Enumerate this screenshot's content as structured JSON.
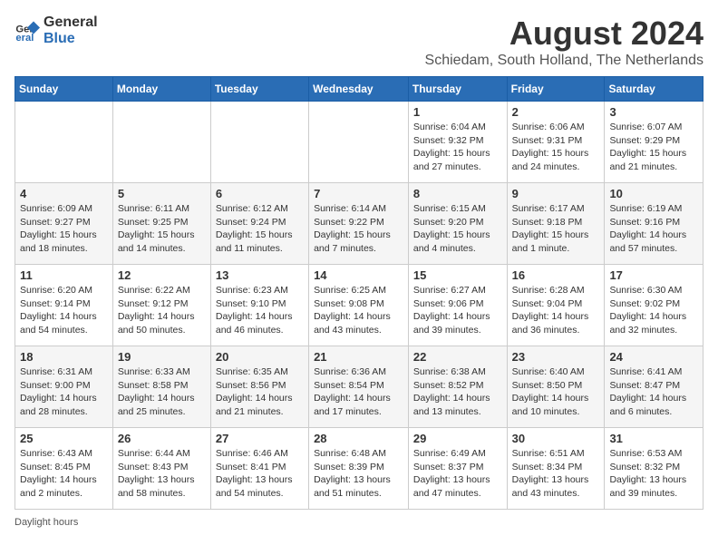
{
  "header": {
    "logo_general": "General",
    "logo_blue": "Blue",
    "main_title": "August 2024",
    "subtitle": "Schiedam, South Holland, The Netherlands"
  },
  "calendar": {
    "days_of_week": [
      "Sunday",
      "Monday",
      "Tuesday",
      "Wednesday",
      "Thursday",
      "Friday",
      "Saturday"
    ],
    "weeks": [
      [
        {
          "day": "",
          "info": ""
        },
        {
          "day": "",
          "info": ""
        },
        {
          "day": "",
          "info": ""
        },
        {
          "day": "",
          "info": ""
        },
        {
          "day": "1",
          "info": "Sunrise: 6:04 AM\nSunset: 9:32 PM\nDaylight: 15 hours and 27 minutes."
        },
        {
          "day": "2",
          "info": "Sunrise: 6:06 AM\nSunset: 9:31 PM\nDaylight: 15 hours and 24 minutes."
        },
        {
          "day": "3",
          "info": "Sunrise: 6:07 AM\nSunset: 9:29 PM\nDaylight: 15 hours and 21 minutes."
        }
      ],
      [
        {
          "day": "4",
          "info": "Sunrise: 6:09 AM\nSunset: 9:27 PM\nDaylight: 15 hours and 18 minutes."
        },
        {
          "day": "5",
          "info": "Sunrise: 6:11 AM\nSunset: 9:25 PM\nDaylight: 15 hours and 14 minutes."
        },
        {
          "day": "6",
          "info": "Sunrise: 6:12 AM\nSunset: 9:24 PM\nDaylight: 15 hours and 11 minutes."
        },
        {
          "day": "7",
          "info": "Sunrise: 6:14 AM\nSunset: 9:22 PM\nDaylight: 15 hours and 7 minutes."
        },
        {
          "day": "8",
          "info": "Sunrise: 6:15 AM\nSunset: 9:20 PM\nDaylight: 15 hours and 4 minutes."
        },
        {
          "day": "9",
          "info": "Sunrise: 6:17 AM\nSunset: 9:18 PM\nDaylight: 15 hours and 1 minute."
        },
        {
          "day": "10",
          "info": "Sunrise: 6:19 AM\nSunset: 9:16 PM\nDaylight: 14 hours and 57 minutes."
        }
      ],
      [
        {
          "day": "11",
          "info": "Sunrise: 6:20 AM\nSunset: 9:14 PM\nDaylight: 14 hours and 54 minutes."
        },
        {
          "day": "12",
          "info": "Sunrise: 6:22 AM\nSunset: 9:12 PM\nDaylight: 14 hours and 50 minutes."
        },
        {
          "day": "13",
          "info": "Sunrise: 6:23 AM\nSunset: 9:10 PM\nDaylight: 14 hours and 46 minutes."
        },
        {
          "day": "14",
          "info": "Sunrise: 6:25 AM\nSunset: 9:08 PM\nDaylight: 14 hours and 43 minutes."
        },
        {
          "day": "15",
          "info": "Sunrise: 6:27 AM\nSunset: 9:06 PM\nDaylight: 14 hours and 39 minutes."
        },
        {
          "day": "16",
          "info": "Sunrise: 6:28 AM\nSunset: 9:04 PM\nDaylight: 14 hours and 36 minutes."
        },
        {
          "day": "17",
          "info": "Sunrise: 6:30 AM\nSunset: 9:02 PM\nDaylight: 14 hours and 32 minutes."
        }
      ],
      [
        {
          "day": "18",
          "info": "Sunrise: 6:31 AM\nSunset: 9:00 PM\nDaylight: 14 hours and 28 minutes."
        },
        {
          "day": "19",
          "info": "Sunrise: 6:33 AM\nSunset: 8:58 PM\nDaylight: 14 hours and 25 minutes."
        },
        {
          "day": "20",
          "info": "Sunrise: 6:35 AM\nSunset: 8:56 PM\nDaylight: 14 hours and 21 minutes."
        },
        {
          "day": "21",
          "info": "Sunrise: 6:36 AM\nSunset: 8:54 PM\nDaylight: 14 hours and 17 minutes."
        },
        {
          "day": "22",
          "info": "Sunrise: 6:38 AM\nSunset: 8:52 PM\nDaylight: 14 hours and 13 minutes."
        },
        {
          "day": "23",
          "info": "Sunrise: 6:40 AM\nSunset: 8:50 PM\nDaylight: 14 hours and 10 minutes."
        },
        {
          "day": "24",
          "info": "Sunrise: 6:41 AM\nSunset: 8:47 PM\nDaylight: 14 hours and 6 minutes."
        }
      ],
      [
        {
          "day": "25",
          "info": "Sunrise: 6:43 AM\nSunset: 8:45 PM\nDaylight: 14 hours and 2 minutes."
        },
        {
          "day": "26",
          "info": "Sunrise: 6:44 AM\nSunset: 8:43 PM\nDaylight: 13 hours and 58 minutes."
        },
        {
          "day": "27",
          "info": "Sunrise: 6:46 AM\nSunset: 8:41 PM\nDaylight: 13 hours and 54 minutes."
        },
        {
          "day": "28",
          "info": "Sunrise: 6:48 AM\nSunset: 8:39 PM\nDaylight: 13 hours and 51 minutes."
        },
        {
          "day": "29",
          "info": "Sunrise: 6:49 AM\nSunset: 8:37 PM\nDaylight: 13 hours and 47 minutes."
        },
        {
          "day": "30",
          "info": "Sunrise: 6:51 AM\nSunset: 8:34 PM\nDaylight: 13 hours and 43 minutes."
        },
        {
          "day": "31",
          "info": "Sunrise: 6:53 AM\nSunset: 8:32 PM\nDaylight: 13 hours and 39 minutes."
        }
      ]
    ]
  },
  "footer": {
    "text": "Daylight hours"
  }
}
